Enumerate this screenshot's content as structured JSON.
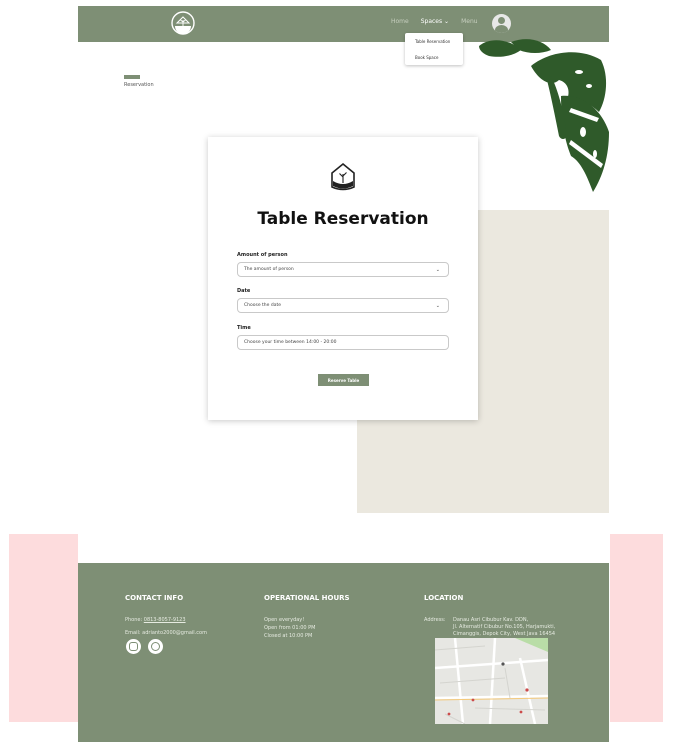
{
  "nav": {
    "links": [
      "Home",
      "Spaces ⌄",
      "Menu"
    ]
  },
  "dropdown": {
    "items": [
      "Table Reservation",
      "Book Space"
    ]
  },
  "breadcrumb": {
    "label": "Reservation"
  },
  "form": {
    "title": "Table Reservation",
    "amount_label": "Amount of person",
    "amount_value": "The amount of person",
    "date_label": "Date",
    "date_value": "Choose the date",
    "time_label": "Time",
    "time_value": "Choose your time between 14:00 - 20:00",
    "submit_label": "Reserve Table"
  },
  "footer": {
    "contact": {
      "heading": "CONTACT INFO",
      "phone_prefix": "Phone: ",
      "phone": "0813-8057-9123",
      "email": "Email: adrianto2000@gmail.com"
    },
    "hours": {
      "heading": "OPERATIONAL HOURS",
      "line1": "Open everyday!",
      "line2": "Open from 01:00 PM",
      "line3": "Closed at 10:00 PM"
    },
    "location": {
      "heading": "LOCATION",
      "address_label": "Address:",
      "address_line1": "Danau Asri Cibubur Kav. DDN,",
      "address_line2": "Jl. Alternatif Cibubur No.105, Harjamukti,",
      "address_line3": "Cimanggis, Depok City, West Java 16454"
    }
  },
  "colors": {
    "primary": "#7e8f75",
    "beige": "#ebe8df",
    "pink": "#fddcdd"
  }
}
